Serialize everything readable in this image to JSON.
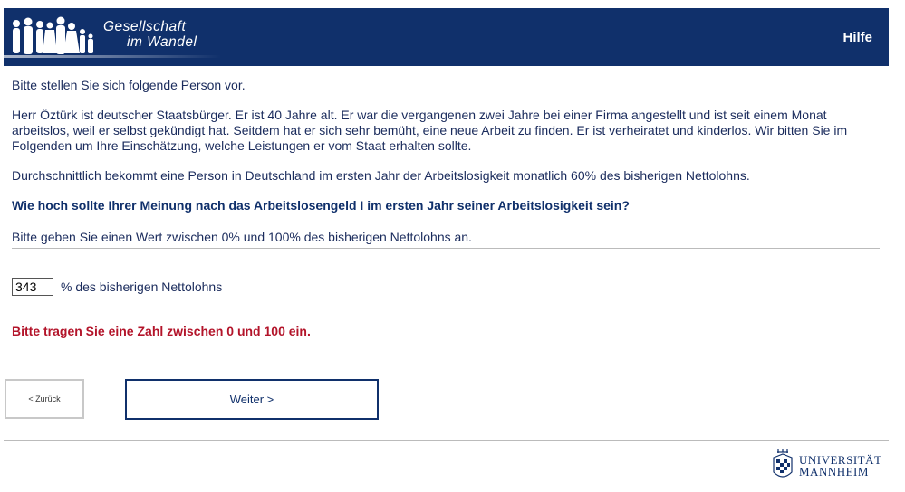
{
  "header": {
    "logo_line1": "Gesellschaft",
    "logo_line2": "im Wandel",
    "help_label": "Hilfe"
  },
  "intro": "Bitte stellen Sie sich folgende Person vor.",
  "scenario": "Herr Öztürk ist deutscher Staatsbürger. Er ist 40 Jahre alt. Er war die vergangenen zwei Jahre bei einer Firma angestellt und ist seit einem Monat arbeitslos, weil er selbst gekündigt hat. Seitdem hat er sich sehr bemüht, eine neue Arbeit zu finden. Er ist verheiratet und kinderlos. Wir bitten Sie im Folgenden um Ihre Einschätzung, welche Leistungen er vom Staat erhalten sollte.",
  "context": "Durchschnittlich bekommt eine Person in Deutschland im ersten Jahr der Arbeitslosigkeit monatlich 60% des bisherigen Nettolohns.",
  "question": "Wie hoch sollte Ihrer Meinung nach das Arbeitslosengeld I im ersten Jahr seiner Arbeitslosigkeit sein?",
  "hint": "Bitte geben Sie einen Wert zwischen 0% und 100% des bisherigen Nettolohns an.",
  "answer": {
    "value": "343",
    "unit": "% des bisherigen Nettolohns"
  },
  "error": "Bitte tragen Sie eine Zahl zwischen 0 und 100 ein.",
  "nav": {
    "back_label": "< Zurück",
    "next_label": "Weiter >"
  },
  "footer": {
    "uni_line1": "UNIVERSITÄT",
    "uni_line2": "MANNHEIM"
  },
  "colors": {
    "brand": "#10306b",
    "error": "#b3142a"
  }
}
